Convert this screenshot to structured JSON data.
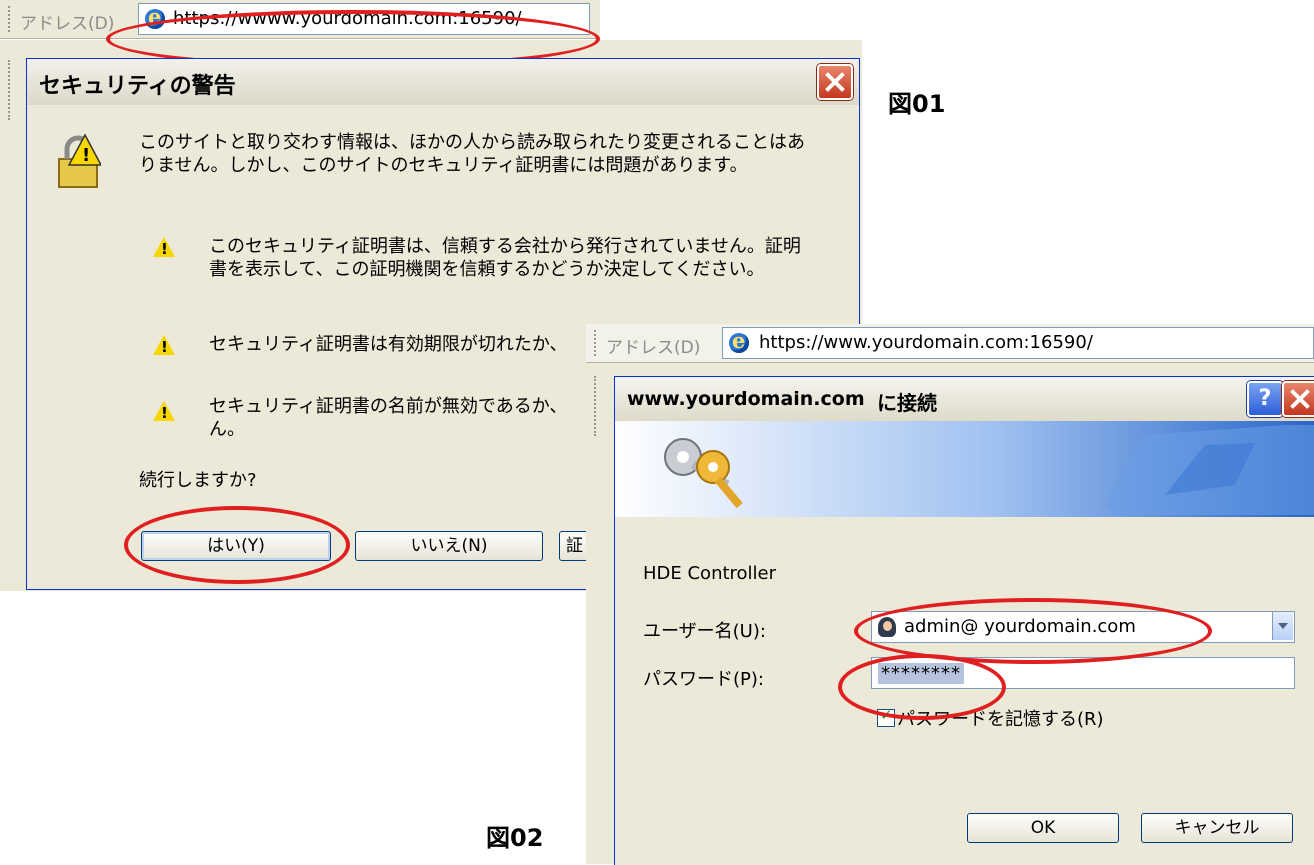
{
  "left": {
    "address_bar": {
      "label": "アドレス(D)",
      "url": "https://wwww.yourdomain.com:16590/"
    },
    "dialog": {
      "title": "セキュリティの警告",
      "intro_line1": "このサイトと取り交わす情報は、ほかの人から読み取られたり変更されることはあ",
      "intro_line2": "りません。しかし、このサイトのセキュリティ証明書には問題があります。",
      "warnings": [
        {
          "line1": "このセキュリティ証明書は、信頼する会社から発行されていません。証明",
          "line2": "書を表示して、この証明機関を信頼するかどうか決定してください。"
        },
        {
          "line1": "セキュリティ証明書は有効期限が切れたか、",
          "line2": ""
        },
        {
          "line1": "セキュリティ証明書の名前が無効であるか、",
          "line2": "ん。"
        }
      ],
      "question": "続行しますか?",
      "yes_button": "はい(Y)",
      "no_button": "いいえ(N)",
      "third_button": "証"
    },
    "figure_label": "図01"
  },
  "right": {
    "address_bar": {
      "label": "アドレス(D)",
      "url": "https://www.yourdomain.com:16590/"
    },
    "dialog": {
      "title_host": "www.yourdomain.com",
      "title_suffix": "に接続",
      "realm": "HDE Controller",
      "username_label": "ユーザー名(U):",
      "username_value": "admin@ yourdomain.com",
      "password_label": "パスワード(P):",
      "password_value": "********",
      "remember_label": "パスワードを記憶する(R)",
      "remember_checked": true,
      "ok_button": "OK",
      "cancel_button": "キャンセル"
    },
    "figure_label": "図02"
  },
  "colors": {
    "highlight_oval": "#e02020",
    "dialog_bg": "#ece9d8",
    "title_border": "#0831d9"
  }
}
